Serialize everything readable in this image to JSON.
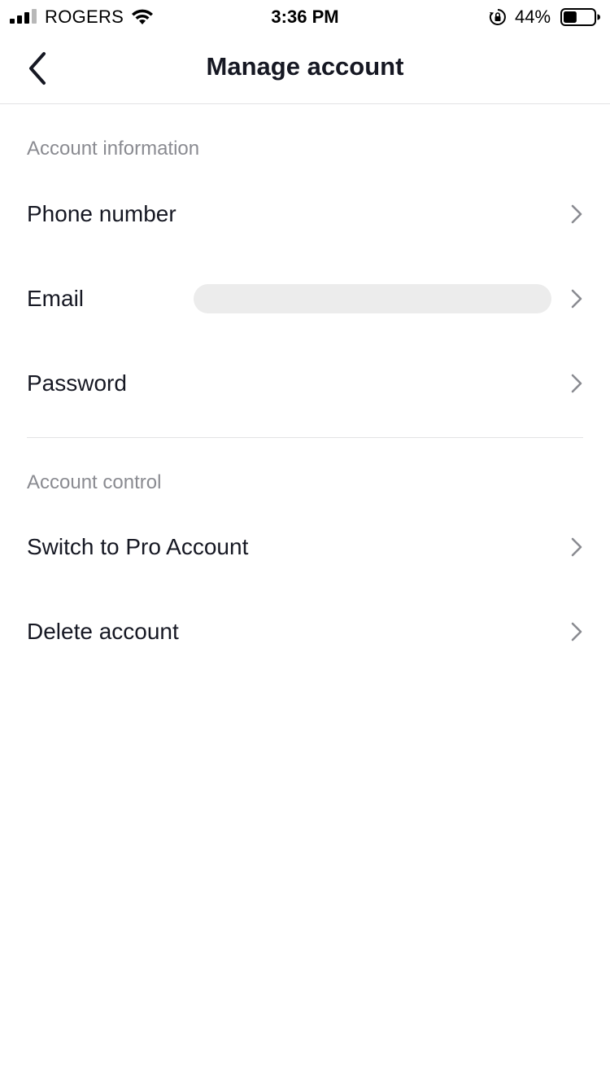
{
  "status_bar": {
    "carrier": "ROGERS",
    "time": "3:36 PM",
    "battery_percent": "44%",
    "battery_level": 0.44,
    "icons": [
      "signal-icon",
      "wifi-icon",
      "orientation-lock-icon",
      "battery-icon"
    ]
  },
  "header": {
    "title": "Manage account",
    "back_icon": "chevron-left-icon"
  },
  "sections": [
    {
      "title": "Account information",
      "items": [
        {
          "label": "Phone number",
          "value": ""
        },
        {
          "label": "Email",
          "value": ""
        },
        {
          "label": "Password",
          "value": ""
        }
      ]
    },
    {
      "title": "Account control",
      "items": [
        {
          "label": "Switch to Pro Account",
          "value": ""
        },
        {
          "label": "Delete account",
          "value": ""
        }
      ]
    }
  ],
  "colors": {
    "text_primary": "#161823",
    "text_secondary": "#8a8b91",
    "divider": "#e3e3e4",
    "redacted_field": "#ececec",
    "chevron": "#8a8b91"
  }
}
